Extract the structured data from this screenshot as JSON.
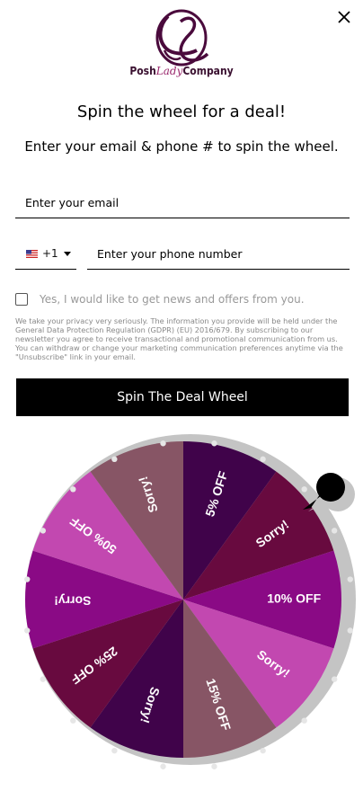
{
  "close": {
    "icon": "close-icon"
  },
  "logo": {
    "brand_left": "Posh",
    "brand_script": "Lady",
    "brand_right": "Company"
  },
  "headline": "Spin the wheel for a deal!",
  "subline": "Enter your email & phone # to spin the wheel.",
  "email": {
    "placeholder": "Enter your email",
    "value": ""
  },
  "phone": {
    "country_code": "+1",
    "country_flag": "us-flag-icon",
    "placeholder": "Enter your phone number",
    "value": ""
  },
  "consent": {
    "label": "Yes, I would like to get news and offers from you.",
    "checked": false
  },
  "privacy_text": "We take your privacy very seriously. The information you provide will be held under the General Data Protection Regulation (GDPR) (EU) 2016/679. By subscribing to our newsletter you agree to receive transactional and promotional communication from us. You can withdraw or change your marketing communication preferences anytime via the \"Unsubscribe\" link in your email.",
  "spin_button": "Spin The Deal Wheel",
  "wheel": {
    "segments": [
      {
        "label": "5% OFF",
        "color": "#40034a"
      },
      {
        "label": "Sorry!",
        "color": "#680a3f"
      },
      {
        "label": "10% OFF",
        "color": "#8a0a85"
      },
      {
        "label": "Sorry!",
        "color": "#c248b0"
      },
      {
        "label": "15% OFF",
        "color": "#875565"
      },
      {
        "label": "Sorry!",
        "color": "#40034a"
      },
      {
        "label": "25% OFF",
        "color": "#680a3f"
      },
      {
        "label": "Sorry!",
        "color": "#8a0a85"
      },
      {
        "label": "50% OFF",
        "color": "#c248b0"
      },
      {
        "label": "Sorry!",
        "color": "#875565"
      }
    ],
    "pointer": "pin-pointer-icon"
  }
}
